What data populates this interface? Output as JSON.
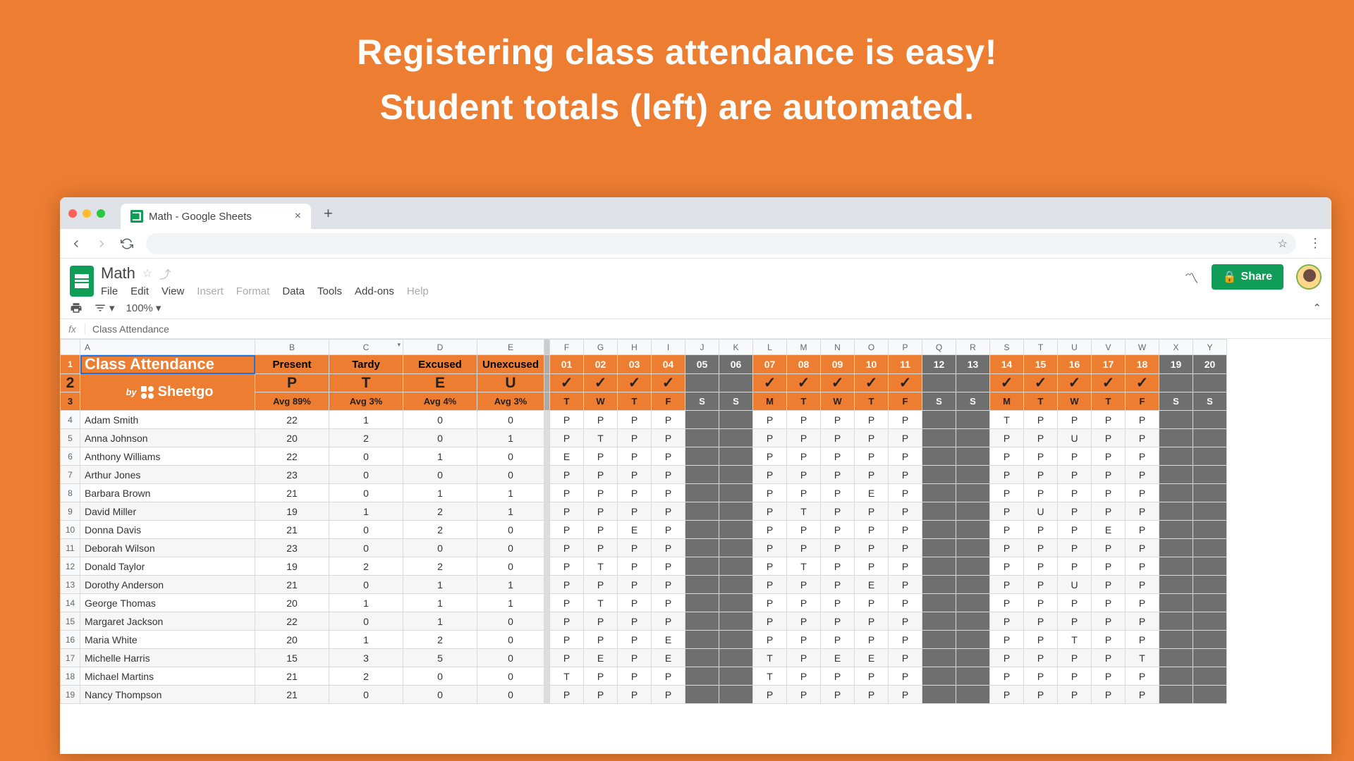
{
  "headline": {
    "line1": "Registering class attendance is easy!",
    "line2": "Student totals (left) are automated."
  },
  "browser": {
    "tab_title": "Math - Google Sheets"
  },
  "doc": {
    "title": "Math",
    "menus": [
      "File",
      "Edit",
      "View",
      "Insert",
      "Format",
      "Data",
      "Tools",
      "Add-ons",
      "Help"
    ],
    "menu_disabled": [
      3,
      4,
      8
    ],
    "share": "Share",
    "zoom": "100%",
    "fx": "Class Attendance"
  },
  "cols": [
    "",
    "A",
    "B",
    "C",
    "D",
    "E",
    "",
    "F",
    "G",
    "H",
    "I",
    "J",
    "K",
    "L",
    "M",
    "N",
    "O",
    "P",
    "Q",
    "R",
    "S",
    "T",
    "U",
    "V",
    "W",
    "X",
    "Y"
  ],
  "header1": {
    "title": "Class Attendance",
    "stats": [
      "Present",
      "Tardy",
      "Excused",
      "Unexcused"
    ],
    "days": [
      "01",
      "02",
      "03",
      "04",
      "05",
      "06",
      "07",
      "08",
      "09",
      "10",
      "11",
      "12",
      "13",
      "14",
      "15",
      "16",
      "17",
      "18",
      "19",
      "20"
    ]
  },
  "header2": {
    "brand_by": "by",
    "brand_name": "Sheetgo",
    "codes": [
      "P",
      "T",
      "E",
      "U"
    ],
    "check": "✓"
  },
  "header3": {
    "avgs": [
      "Avg 89%",
      "Avg 3%",
      "Avg 4%",
      "Avg 3%"
    ],
    "dow": [
      "T",
      "W",
      "T",
      "F",
      "S",
      "S",
      "M",
      "T",
      "W",
      "T",
      "F",
      "S",
      "S",
      "M",
      "T",
      "W",
      "T",
      "F",
      "S",
      "S"
    ]
  },
  "weekend_idx": [
    4,
    5,
    11,
    12,
    18,
    19
  ],
  "students": [
    {
      "n": 4,
      "name": "Adam Smith",
      "s": [
        22,
        1,
        0,
        0
      ],
      "d": [
        "P",
        "P",
        "P",
        "P",
        "",
        "",
        "P",
        "P",
        "P",
        "P",
        "P",
        "",
        "",
        "T",
        "P",
        "P",
        "P",
        "P",
        "",
        ""
      ]
    },
    {
      "n": 5,
      "name": "Anna Johnson",
      "s": [
        20,
        2,
        0,
        1
      ],
      "d": [
        "P",
        "T",
        "P",
        "P",
        "",
        "",
        "P",
        "P",
        "P",
        "P",
        "P",
        "",
        "",
        "P",
        "P",
        "U",
        "P",
        "P",
        "",
        ""
      ]
    },
    {
      "n": 6,
      "name": "Anthony Williams",
      "s": [
        22,
        0,
        1,
        0
      ],
      "d": [
        "E",
        "P",
        "P",
        "P",
        "",
        "",
        "P",
        "P",
        "P",
        "P",
        "P",
        "",
        "",
        "P",
        "P",
        "P",
        "P",
        "P",
        "",
        ""
      ]
    },
    {
      "n": 7,
      "name": "Arthur Jones",
      "s": [
        23,
        0,
        0,
        0
      ],
      "d": [
        "P",
        "P",
        "P",
        "P",
        "",
        "",
        "P",
        "P",
        "P",
        "P",
        "P",
        "",
        "",
        "P",
        "P",
        "P",
        "P",
        "P",
        "",
        ""
      ]
    },
    {
      "n": 8,
      "name": "Barbara Brown",
      "s": [
        21,
        0,
        1,
        1
      ],
      "d": [
        "P",
        "P",
        "P",
        "P",
        "",
        "",
        "P",
        "P",
        "P",
        "E",
        "P",
        "",
        "",
        "P",
        "P",
        "P",
        "P",
        "P",
        "",
        ""
      ]
    },
    {
      "n": 9,
      "name": "David Miller",
      "s": [
        19,
        1,
        2,
        1
      ],
      "d": [
        "P",
        "P",
        "P",
        "P",
        "",
        "",
        "P",
        "T",
        "P",
        "P",
        "P",
        "",
        "",
        "P",
        "U",
        "P",
        "P",
        "P",
        "",
        ""
      ]
    },
    {
      "n": 10,
      "name": "Donna Davis",
      "s": [
        21,
        0,
        2,
        0
      ],
      "d": [
        "P",
        "P",
        "E",
        "P",
        "",
        "",
        "P",
        "P",
        "P",
        "P",
        "P",
        "",
        "",
        "P",
        "P",
        "P",
        "E",
        "P",
        "",
        ""
      ]
    },
    {
      "n": 11,
      "name": "Deborah Wilson",
      "s": [
        23,
        0,
        0,
        0
      ],
      "d": [
        "P",
        "P",
        "P",
        "P",
        "",
        "",
        "P",
        "P",
        "P",
        "P",
        "P",
        "",
        "",
        "P",
        "P",
        "P",
        "P",
        "P",
        "",
        ""
      ]
    },
    {
      "n": 12,
      "name": "Donald Taylor",
      "s": [
        19,
        2,
        2,
        0
      ],
      "d": [
        "P",
        "T",
        "P",
        "P",
        "",
        "",
        "P",
        "T",
        "P",
        "P",
        "P",
        "",
        "",
        "P",
        "P",
        "P",
        "P",
        "P",
        "",
        ""
      ]
    },
    {
      "n": 13,
      "name": "Dorothy Anderson",
      "s": [
        21,
        0,
        1,
        1
      ],
      "d": [
        "P",
        "P",
        "P",
        "P",
        "",
        "",
        "P",
        "P",
        "P",
        "E",
        "P",
        "",
        "",
        "P",
        "P",
        "U",
        "P",
        "P",
        "",
        ""
      ]
    },
    {
      "n": 14,
      "name": "George Thomas",
      "s": [
        20,
        1,
        1,
        1
      ],
      "d": [
        "P",
        "T",
        "P",
        "P",
        "",
        "",
        "P",
        "P",
        "P",
        "P",
        "P",
        "",
        "",
        "P",
        "P",
        "P",
        "P",
        "P",
        "",
        ""
      ]
    },
    {
      "n": 15,
      "name": "Margaret Jackson",
      "s": [
        22,
        0,
        1,
        0
      ],
      "d": [
        "P",
        "P",
        "P",
        "P",
        "",
        "",
        "P",
        "P",
        "P",
        "P",
        "P",
        "",
        "",
        "P",
        "P",
        "P",
        "P",
        "P",
        "",
        ""
      ]
    },
    {
      "n": 16,
      "name": "Maria White",
      "s": [
        20,
        1,
        2,
        0
      ],
      "d": [
        "P",
        "P",
        "P",
        "E",
        "",
        "",
        "P",
        "P",
        "P",
        "P",
        "P",
        "",
        "",
        "P",
        "P",
        "T",
        "P",
        "P",
        "",
        ""
      ]
    },
    {
      "n": 17,
      "name": "Michelle Harris",
      "s": [
        15,
        3,
        5,
        0
      ],
      "d": [
        "P",
        "E",
        "P",
        "E",
        "",
        "",
        "T",
        "P",
        "E",
        "E",
        "P",
        "",
        "",
        "P",
        "P",
        "P",
        "P",
        "T",
        "",
        ""
      ]
    },
    {
      "n": 18,
      "name": "Michael Martins",
      "s": [
        21,
        2,
        0,
        0
      ],
      "d": [
        "T",
        "P",
        "P",
        "P",
        "",
        "",
        "T",
        "P",
        "P",
        "P",
        "P",
        "",
        "",
        "P",
        "P",
        "P",
        "P",
        "P",
        "",
        ""
      ]
    },
    {
      "n": 19,
      "name": "Nancy Thompson",
      "s": [
        21,
        0,
        0,
        0
      ],
      "d": [
        "P",
        "P",
        "P",
        "P",
        "",
        "",
        "P",
        "P",
        "P",
        "P",
        "P",
        "",
        "",
        "P",
        "P",
        "P",
        "P",
        "P",
        "",
        ""
      ]
    }
  ]
}
